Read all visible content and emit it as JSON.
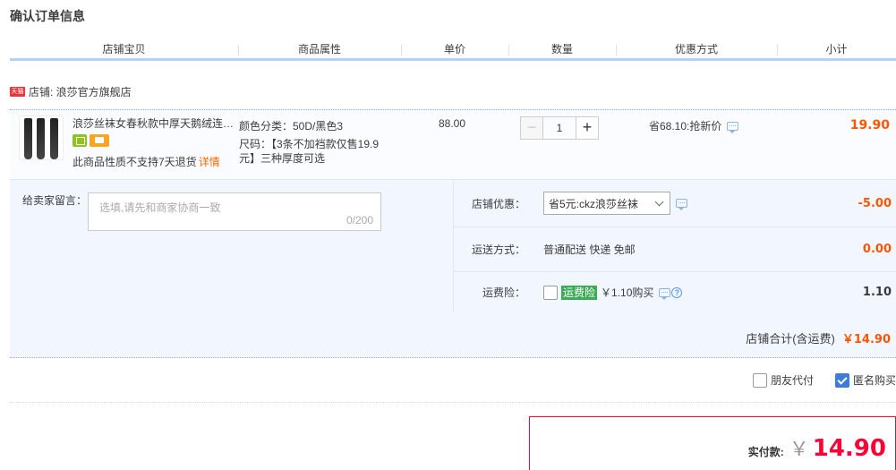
{
  "page_title": "确认订单信息",
  "columns": [
    {
      "label": "店铺宝贝",
      "width": 255
    },
    {
      "label": "商品属性",
      "width": 182
    },
    {
      "label": "单价",
      "width": 120
    },
    {
      "label": "数量",
      "width": 120
    },
    {
      "label": "优惠方式",
      "width": 180
    },
    {
      "label": "小计",
      "width": 133
    }
  ],
  "shop": {
    "badge": "天猫",
    "label": "店铺: 浪莎官方旗舰店"
  },
  "item": {
    "title": "浪莎丝袜女春秋款中厚天鹅绒连…",
    "attr_color": "颜色分类：50D/黑色3",
    "attr_size_1": "尺码：【3条不加裆款仅售19.9",
    "attr_size_2": "元】三种厚度可选",
    "no_return": "此商品性质不支持7天退货",
    "detail_link": "详情",
    "unit_price": "88.00",
    "quantity": "1",
    "minus": "−",
    "plus": "+",
    "discount": "省68.10:抢新价",
    "subtotal": "19.90"
  },
  "memo": {
    "label": "给卖家留言：",
    "placeholder": "选填,请先和商家协商一致",
    "count": "0/200"
  },
  "shop_discount": {
    "label": "店铺优惠：",
    "selected": "省5元:ckz浪莎丝袜",
    "amount": "-5.00"
  },
  "shipping": {
    "label": "运送方式：",
    "value": "普通配送 快递 免邮",
    "amount": "0.00"
  },
  "insurance": {
    "label": "运费险：",
    "tag": "运费险",
    "text": "￥1.10购买",
    "amount": "1.10"
  },
  "shop_total": {
    "label": "店铺合计(含运费)",
    "value": "￥14.90"
  },
  "pay_options": {
    "friend_pay": "朋友代付",
    "anonymous": "匿名购买"
  },
  "total": {
    "label": "实付款:",
    "currency": "￥",
    "value": "14.90"
  },
  "colors": {
    "price_red": "#ff5500",
    "total_red": "#ff0036",
    "header_line": "#b2d1ff",
    "insurance_green": "#3bab55"
  }
}
